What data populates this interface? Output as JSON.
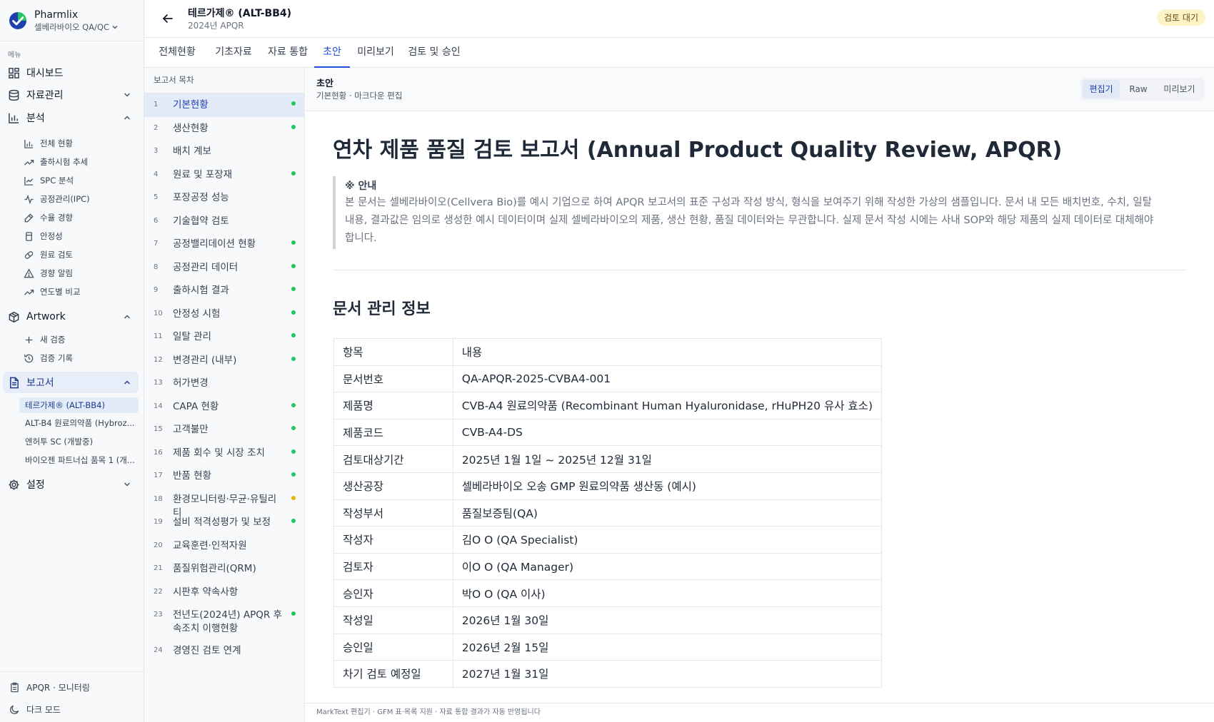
{
  "brand": {
    "name": "Pharmlix",
    "org": "셀베라바이오 QA/QC"
  },
  "sidebar": {
    "menu_caption": "메뉴",
    "dashboard": "대시보드",
    "data_mgmt": "자료관리",
    "analysis": {
      "label": "분석",
      "items": [
        "전체 현황",
        "출하시험 추세",
        "SPC 분석",
        "공정관리(IPC)",
        "수율 경향",
        "안정성",
        "원료 검토",
        "경향 알림",
        "연도별 비교"
      ]
    },
    "artwork": {
      "label": "Artwork",
      "items": [
        "새 검증",
        "검증 기록"
      ]
    },
    "reports": {
      "label": "보고서",
      "items": [
        "테르가제® (ALT-BB4)",
        "ALT-B4 원료의약품 (Hybroz...",
        "엔허투 SC (개발중)",
        "바이오젠 파트너십 품목 1 (개..."
      ]
    },
    "settings": "설정",
    "footer": {
      "monitoring": "APQR · 모니터링",
      "dark_mode": "다크 모드"
    }
  },
  "header": {
    "title": "테르가제® (ALT-BB4)",
    "subtitle": "2024년 APQR",
    "status": "검토 대기"
  },
  "tabs": [
    "전체현황",
    "기초자료",
    "자료 통합",
    "초안",
    "미리보기",
    "검토 및 승인"
  ],
  "toc": {
    "title": "보고서 목차",
    "items": [
      {
        "num": "1",
        "label": "기본현황",
        "status": "done"
      },
      {
        "num": "2",
        "label": "생산현황",
        "status": "done"
      },
      {
        "num": "3",
        "label": "배치 계보",
        "status": "none"
      },
      {
        "num": "4",
        "label": "원료 및 포장재",
        "status": "done"
      },
      {
        "num": "5",
        "label": "포장공정 성능",
        "status": "none"
      },
      {
        "num": "6",
        "label": "기술협약 검토",
        "status": "none"
      },
      {
        "num": "7",
        "label": "공정밸리데이션 현황",
        "status": "done"
      },
      {
        "num": "8",
        "label": "공정관리 데이터",
        "status": "done"
      },
      {
        "num": "9",
        "label": "출하시험 결과",
        "status": "done"
      },
      {
        "num": "10",
        "label": "안정성 시험",
        "status": "done"
      },
      {
        "num": "11",
        "label": "일탈 관리",
        "status": "done"
      },
      {
        "num": "12",
        "label": "변경관리 (내부)",
        "status": "done"
      },
      {
        "num": "13",
        "label": "허가변경",
        "status": "none"
      },
      {
        "num": "14",
        "label": "CAPA 현황",
        "status": "done"
      },
      {
        "num": "15",
        "label": "고객불만",
        "status": "done"
      },
      {
        "num": "16",
        "label": "제품 회수 및 시장 조치",
        "status": "done"
      },
      {
        "num": "17",
        "label": "반품 현황",
        "status": "done"
      },
      {
        "num": "18",
        "label": "환경모니터링·무균·유틸리티",
        "status": "warn"
      },
      {
        "num": "19",
        "label": "설비 적격성평가 및 보정",
        "status": "done"
      },
      {
        "num": "20",
        "label": "교육훈련·인적자원",
        "status": "none"
      },
      {
        "num": "21",
        "label": "품질위험관리(QRM)",
        "status": "none"
      },
      {
        "num": "22",
        "label": "시판후 약속사항",
        "status": "none"
      },
      {
        "num": "23",
        "label": "전년도(2024년) APQR 후속조치 이행현황",
        "status": "done"
      },
      {
        "num": "24",
        "label": "경영진 검토 연계",
        "status": "none"
      }
    ]
  },
  "editor": {
    "title": "초안",
    "subtitle": "기본현황 · 마크다운 편집",
    "modes": [
      "편집기",
      "Raw",
      "미리보기"
    ],
    "h1": "연차 제품 품질 검토 보고서 (Annual Product Quality Review, APQR)",
    "notice_title": "※ 안내",
    "notice_text": "본 문서는 셀베라바이오(Cellvera Bio)를 예시 기업으로 하여 APQR 보고서의 표준 구성과 작성 방식, 형식을 보여주기 위해 작성한 가상의 샘플입니다. 문서 내 모든 배치번호, 수치, 일탈 내용, 결과값은 임의로 생성한 예시 데이터이며 실제 셀베라바이오의 제품, 생산 현황, 품질 데이터와는 무관합니다. 실제 문서 작성 시에는 사내 SOP와 해당 제품의 실제 데이터로 대체해야 합니다.",
    "h2": "문서 관리 정보",
    "table": [
      [
        "항목",
        "내용"
      ],
      [
        "문서번호",
        "QA-APQR-2025-CVBA4-001"
      ],
      [
        "제품명",
        "CVB-A4 원료의약품 (Recombinant Human Hyaluronidase, rHuPH20 유사 효소)"
      ],
      [
        "제품코드",
        "CVB-A4-DS"
      ],
      [
        "검토대상기간",
        "2025년 1월 1일 ~ 2025년 12월 31일"
      ],
      [
        "생산공장",
        "셀베라바이오 오송 GMP 원료의약품 생산동 (예시)"
      ],
      [
        "작성부서",
        "품질보증팀(QA)"
      ],
      [
        "작성자",
        "김O O (QA Specialist)"
      ],
      [
        "검토자",
        "이O O (QA Manager)"
      ],
      [
        "승인자",
        "박O O (QA 이사)"
      ],
      [
        "작성일",
        "2026년 1월 30일"
      ],
      [
        "승인일",
        "2026년 2월 15일"
      ],
      [
        "차기 검토 예정일",
        "2027년 1월 31일"
      ]
    ],
    "footer": "MarkText 편집기 · GFM 표·목록 지원 · 자료 통합 결과가 자동 반영됩니다"
  },
  "colors": {
    "accent": "#1d4ed8",
    "done_dot": "#22c55e",
    "warn_dot": "#eab308",
    "badge_bg": "#fdf3c7"
  }
}
